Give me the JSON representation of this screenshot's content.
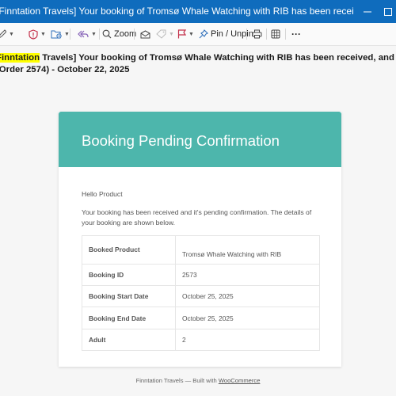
{
  "window": {
    "title": "[Finntation Travels] Your booking of Tromsø Whale Watching with RIB has been received, and it's pending confirmatio...",
    "minimize_icon": "minimize-icon",
    "maximize_icon": "maximize-icon"
  },
  "toolbar": {
    "zoom_label": "Zoom",
    "pin_label": "Pin / Unpin",
    "more_label": "···"
  },
  "subject": {
    "line1_highlight": "Finntation",
    "line1_rest": " Travels] Your booking of Tromsø Whale Watching with RIB has been received, and it's pending confirmatio",
    "line2": "(Order 2574) - October 22, 2025"
  },
  "email": {
    "header_title": "Booking Pending Confirmation",
    "greeting": "Hello Product",
    "intro": "Your booking has been received and it's pending confirmation. The details of your booking are shown below.",
    "details": [
      {
        "label": "Booked Product",
        "value": "Tromsø Whale Watching with RIB"
      },
      {
        "label": "Booking ID",
        "value": "2573"
      },
      {
        "label": "Booking Start Date",
        "value": "October 25, 2025"
      },
      {
        "label": "Booking End Date",
        "value": "October 25, 2025"
      },
      {
        "label": "Adult",
        "value": "2"
      }
    ],
    "footer_text": "Finntation Travels — Built with ",
    "footer_link": "WooCommerce"
  },
  "colors": {
    "titlebar": "#0f6cbd",
    "header": "#4db6ac",
    "highlight": "#ffff00"
  }
}
